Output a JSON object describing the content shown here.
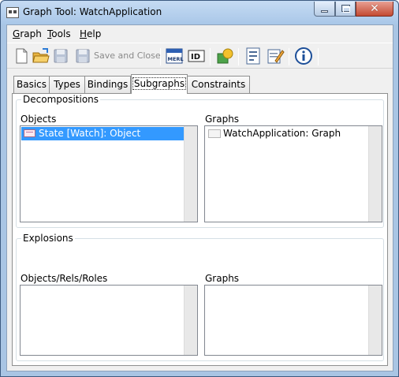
{
  "window": {
    "title": "Graph Tool: WatchApplication"
  },
  "menubar": {
    "items": [
      {
        "accel": "G",
        "rest": "raph"
      },
      {
        "accel": "T",
        "rest": "ools"
      },
      {
        "accel": "H",
        "rest": "elp"
      }
    ]
  },
  "toolbar": {
    "save_and_close_label": "Save and Close",
    "buttons": [
      "new-document-icon",
      "open-folder-icon",
      "save-disk-icon",
      "save-and-close-disk-icon",
      "merl-icon",
      "id-icon",
      "shapes-icon",
      "form-icon",
      "edit-icon",
      "info-icon"
    ]
  },
  "tabs": [
    {
      "label": "Basics"
    },
    {
      "label": "Types"
    },
    {
      "label": "Bindings"
    },
    {
      "label": "Subgraphs",
      "active": true
    },
    {
      "label": "Constraints"
    }
  ],
  "decompositions": {
    "title": "Decompositions",
    "objects_label": "Objects",
    "graphs_label": "Graphs",
    "objects": [
      {
        "text": "State [Watch]: Object",
        "selected": true
      }
    ],
    "graphs": [
      {
        "text": "WatchApplication: Graph",
        "selected": false
      }
    ]
  },
  "explosions": {
    "title": "Explosions",
    "objects_label": "Objects/Rels/Roles",
    "graphs_label": "Graphs"
  },
  "colors": {
    "selection": "#3399ff",
    "titlebar": "#a9c5e4",
    "close_button": "#c44a32"
  }
}
